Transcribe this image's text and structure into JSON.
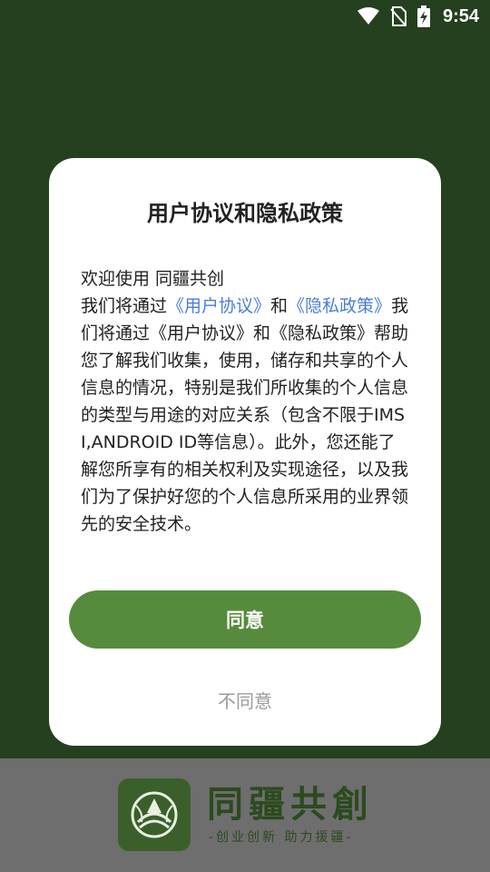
{
  "status_bar": {
    "time": "9:54",
    "icons": [
      "wifi-icon",
      "no-sim-icon",
      "battery-charging-icon"
    ]
  },
  "dialog": {
    "title": "用户协议和隐私政策",
    "welcome": "欢迎使用   同疆共创",
    "intro": "我们将通过",
    "user_agreement_link": "《用户协议》",
    "and": "和",
    "privacy_policy_link": "《隐私政策》",
    "body": "我们将通过《用户协议》和《隐私政策》帮助您了解我们收集，使用，储存和共享的个人信息的情况，特别是我们所收集的个人信息的类型与用途的对应关系（包含不限于IMSI,ANDROID ID等信息）。此外，您还能了解您所享有的相关权利及实现途径，以及我们为了保护好您的个人信息所采用的业界领先的安全技术。",
    "agree_label": "同意",
    "disagree_label": "不同意"
  },
  "brand": {
    "name": "同疆共創",
    "slogan": "-创业创新 助力援疆-"
  },
  "colors": {
    "background": "#25401e",
    "accent": "#568b3d",
    "link": "#4a7ed8",
    "bottom_area": "#6e6e6e"
  }
}
